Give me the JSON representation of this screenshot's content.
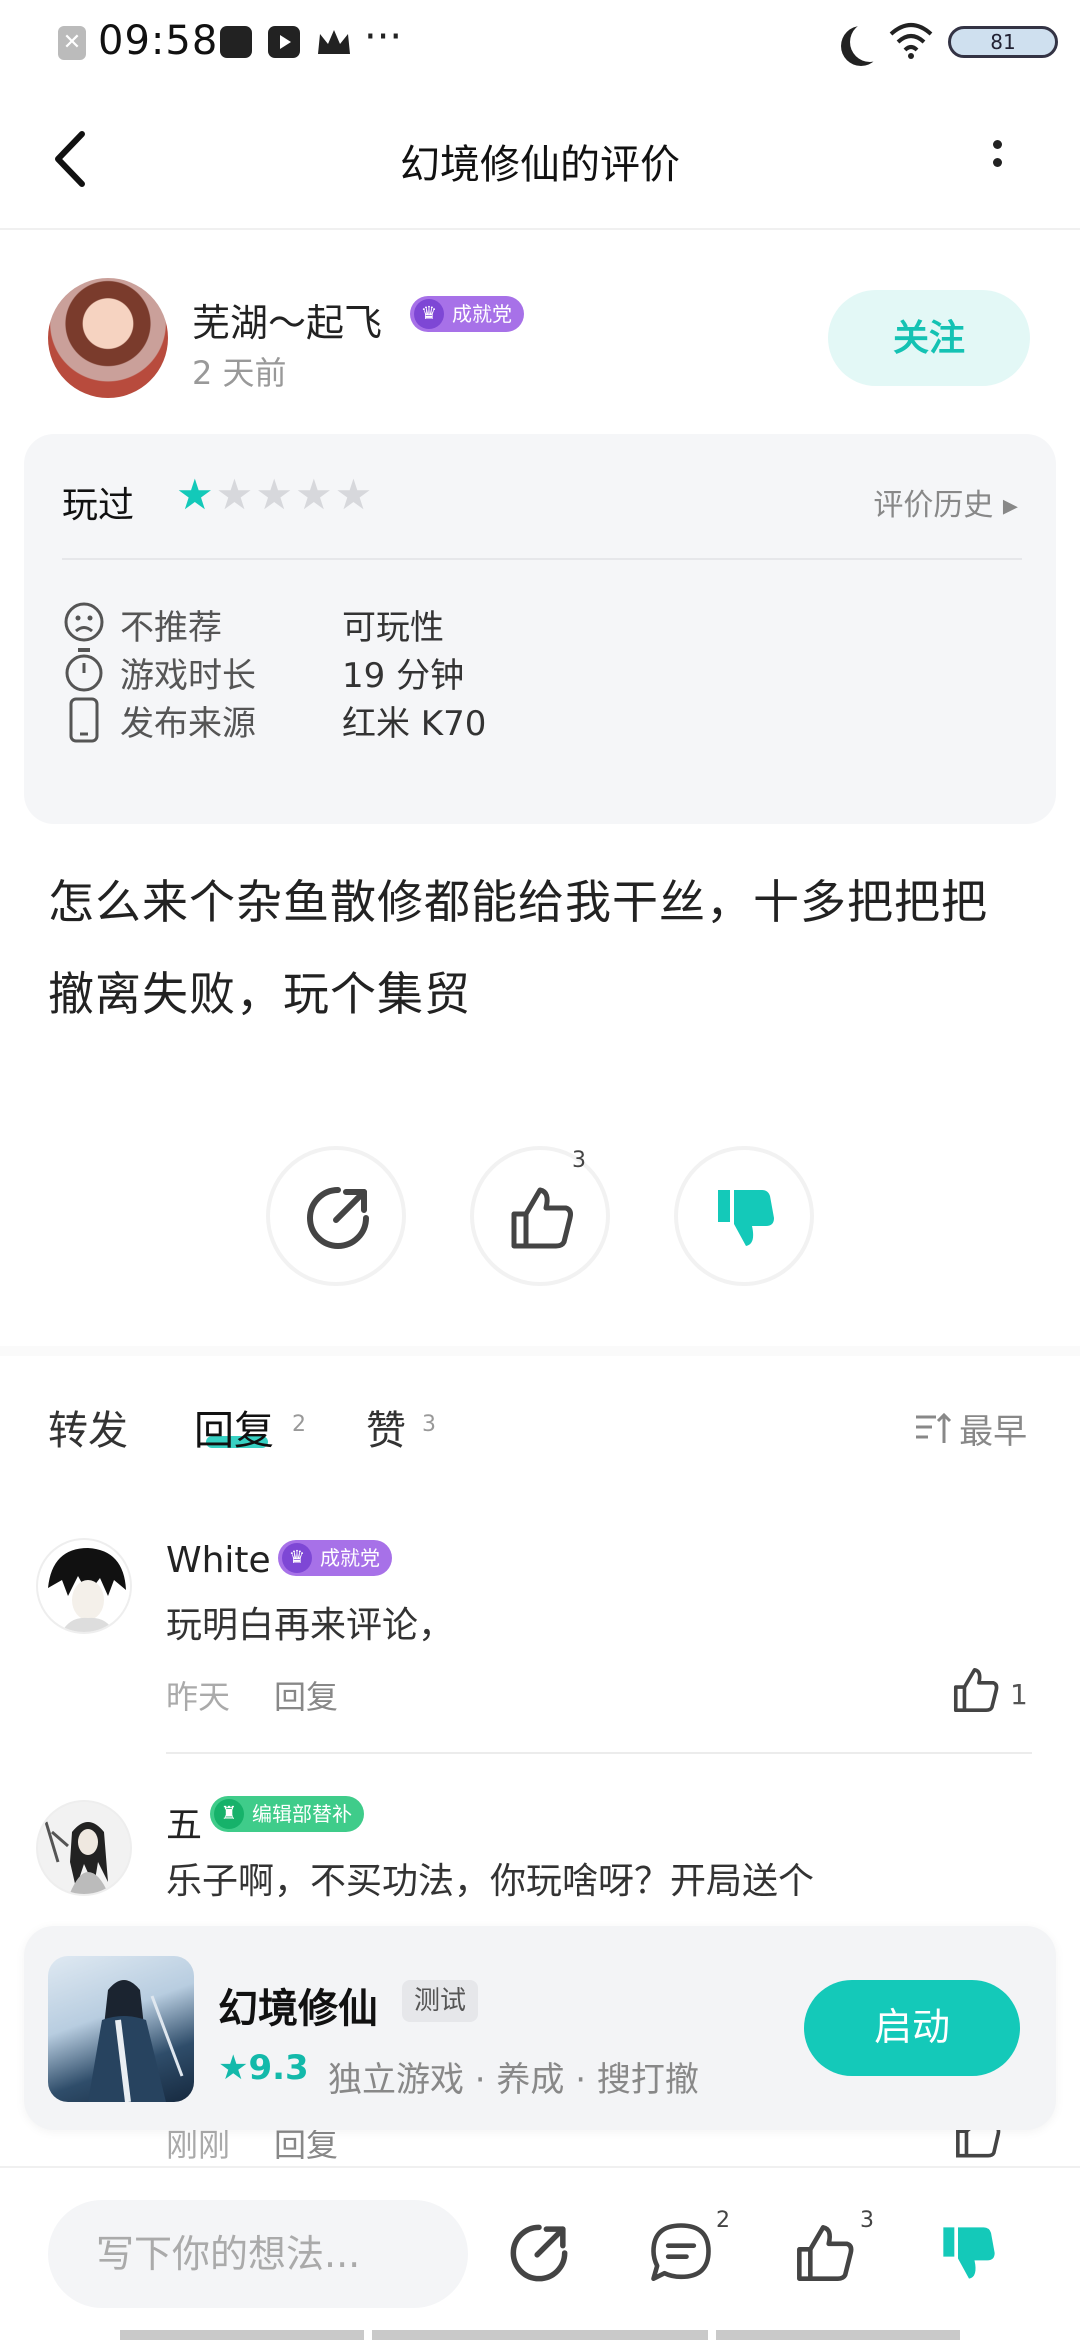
{
  "status_bar": {
    "time": "09:58",
    "dots": "···",
    "battery": "81"
  },
  "nav": {
    "title": "幻境修仙的评价"
  },
  "author": {
    "name": "芜湖～起飞",
    "badge": "成就党",
    "time_ago": "2 天前",
    "follow_label": "关注"
  },
  "info_card": {
    "played_label": "玩过",
    "rating": 1,
    "rating_max": 5,
    "history_label": "评价历史 ▸",
    "rows": [
      {
        "icon": "frown-icon",
        "label": "不推荐",
        "value": "可玩性"
      },
      {
        "icon": "timer-icon",
        "label": "游戏时长",
        "value": "19 分钟"
      },
      {
        "icon": "phone-icon",
        "label": "发布来源",
        "value": "红米 K70"
      }
    ]
  },
  "review": {
    "text": "怎么来个杂鱼散修都能给我干丝，十多把把把撤离失败，玩个集贸"
  },
  "actions": {
    "like_count": "3"
  },
  "tabs": {
    "forward": "转发",
    "reply": "回复",
    "reply_count": "2",
    "like": "赞",
    "like_count": "3",
    "sort_label": "最早"
  },
  "comments": [
    {
      "name": "White",
      "badge": "成就党",
      "text": "玩明白再来评论，",
      "time": "昨天",
      "reply_label": "回复",
      "likes": "1"
    },
    {
      "name": "五",
      "badge": "编辑部替补",
      "text": "乐子啊，不买功法，你玩啥呀？开局送个",
      "time": "刚刚",
      "reply_label": "回复",
      "likes": ""
    }
  ],
  "game_card": {
    "title": "幻境修仙",
    "tag": "测试",
    "score": "★9.3",
    "tags": "独立游戏 · 养成 · 搜打撤",
    "launch_label": "启动"
  },
  "bottom_bar": {
    "input_placeholder": "写下你的想法...",
    "comment_count": "2",
    "like_count": "3"
  },
  "colors": {
    "accent": "#14c9b9",
    "badge_purple": "#a771e8",
    "badge_green": "#3fcc8a"
  }
}
